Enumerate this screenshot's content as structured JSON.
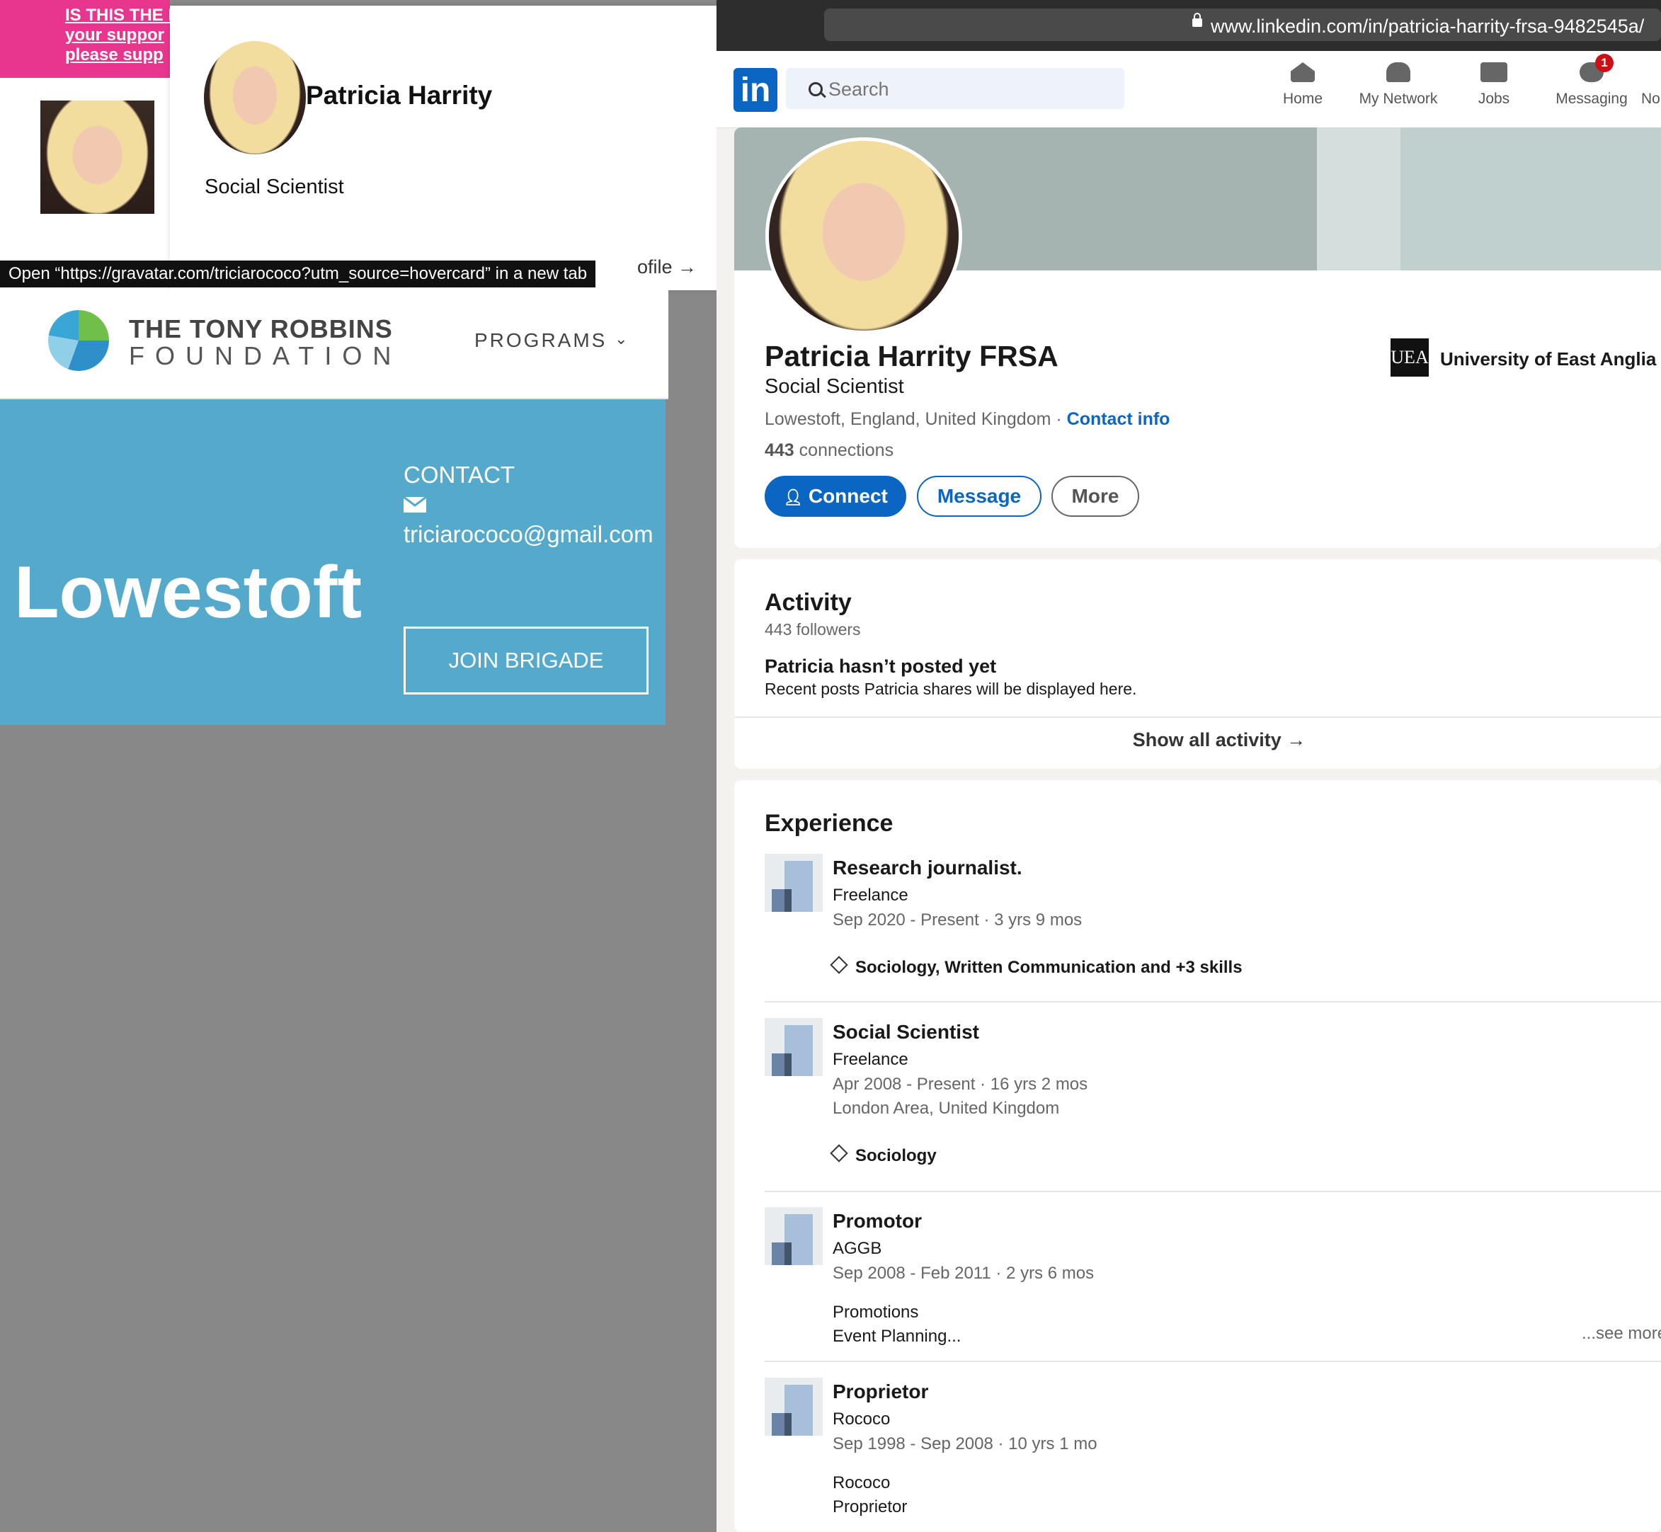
{
  "gravatar": {
    "banner_lines": [
      "IS THIS THE E",
      "your suppor",
      "please supp"
    ],
    "hovercard": {
      "name": "Patricia Harrity",
      "title": "Social Scientist",
      "profile_link": "ofile →"
    },
    "tooltip": "Open “https://gravatar.com/triciarococo?utm_source=hovercard” in a new tab"
  },
  "tony": {
    "logo_line1": "THE TONY ROBBINS",
    "logo_line2": "FOUNDATION",
    "nav_programs": "PROGRAMS",
    "city": "Lowestoft",
    "contact_label": "CONTACT",
    "email": "triciarococo@gmail.com",
    "join_button": "JOIN BRIGADE"
  },
  "browser": {
    "url": "www.linkedin.com/in/patricia-harrity-frsa-9482545a/"
  },
  "linkedin": {
    "logo": "in",
    "search_placeholder": "Search",
    "nav": {
      "home": "Home",
      "network": "My Network",
      "jobs": "Jobs",
      "messaging": "Messaging",
      "messaging_badge": "1",
      "notifications": "No"
    },
    "profile": {
      "name": "Patricia Harrity FRSA",
      "headline": "Social Scientist",
      "location": "Lowestoft, England, United Kingdom",
      "location_sep": " · ",
      "contact_info": "Contact info",
      "connections_count": "443",
      "connections_label": " connections",
      "education": "University of East Anglia",
      "education_logo": "UEA",
      "buttons": {
        "connect": "Connect",
        "message": "Message",
        "more": "More"
      }
    },
    "activity": {
      "title": "Activity",
      "followers": "443 followers",
      "empty_title": "Patricia hasn’t posted yet",
      "empty_desc": "Recent posts Patricia shares will be displayed here.",
      "show_all": "Show all activity →"
    },
    "experience": {
      "title": "Experience",
      "items": [
        {
          "role": "Research journalist.",
          "org": "Freelance",
          "dates": "Sep 2020 - Present · 3 yrs 9 mos",
          "skills": "Sociology, Written Communication and +3 skills"
        },
        {
          "role": "Social Scientist",
          "org": "Freelance",
          "dates": "Apr 2008 - Present · 16 yrs 2 mos",
          "location": "London Area, United Kingdom",
          "skills": "Sociology"
        },
        {
          "role": "Promotor",
          "org": "AGGB",
          "dates": "Sep 2008 - Feb 2011 · 2 yrs 6 mos",
          "desc1": "Promotions",
          "desc2": "Event Planning..."
        },
        {
          "role": "Proprietor",
          "org": "Rococo",
          "dates": "Sep 1998 - Sep 2008 · 10 yrs 1 mo",
          "desc1": "Rococo",
          "desc2": "Proprietor"
        }
      ],
      "see_more": "...see more"
    }
  }
}
